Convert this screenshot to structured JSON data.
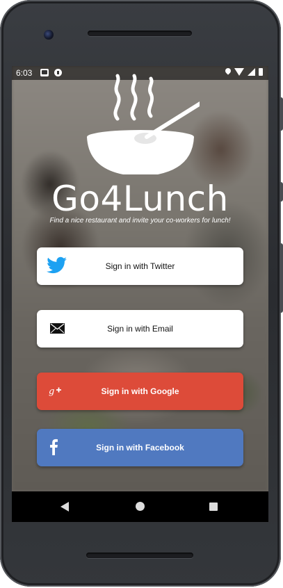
{
  "status_bar": {
    "time": "6:03",
    "icons": [
      "gmail-icon",
      "app-notification-icon",
      "location-icon",
      "wifi-icon",
      "signal-icon",
      "battery-icon"
    ]
  },
  "app": {
    "title": "Go4Lunch",
    "tagline": "Find a nice restaurant and invite your co-workers for lunch!",
    "logo_icon": "steaming-bowl-icon"
  },
  "buttons": {
    "twitter": {
      "label": "Sign in with Twitter",
      "icon": "twitter-bird-icon",
      "color": "#ffffff",
      "icon_color": "#1da1f2"
    },
    "email": {
      "label": "Sign in with Email",
      "icon": "envelope-icon",
      "color": "#ffffff"
    },
    "google": {
      "label": "Sign in with Google",
      "icon": "google-plus-icon",
      "color": "#dd4b39"
    },
    "facebook": {
      "label": "Sign in with Facebook",
      "icon": "facebook-f-icon",
      "color": "#5079c0"
    }
  },
  "nav_bar": {
    "buttons": [
      "back-icon",
      "home-icon",
      "recents-icon"
    ]
  }
}
